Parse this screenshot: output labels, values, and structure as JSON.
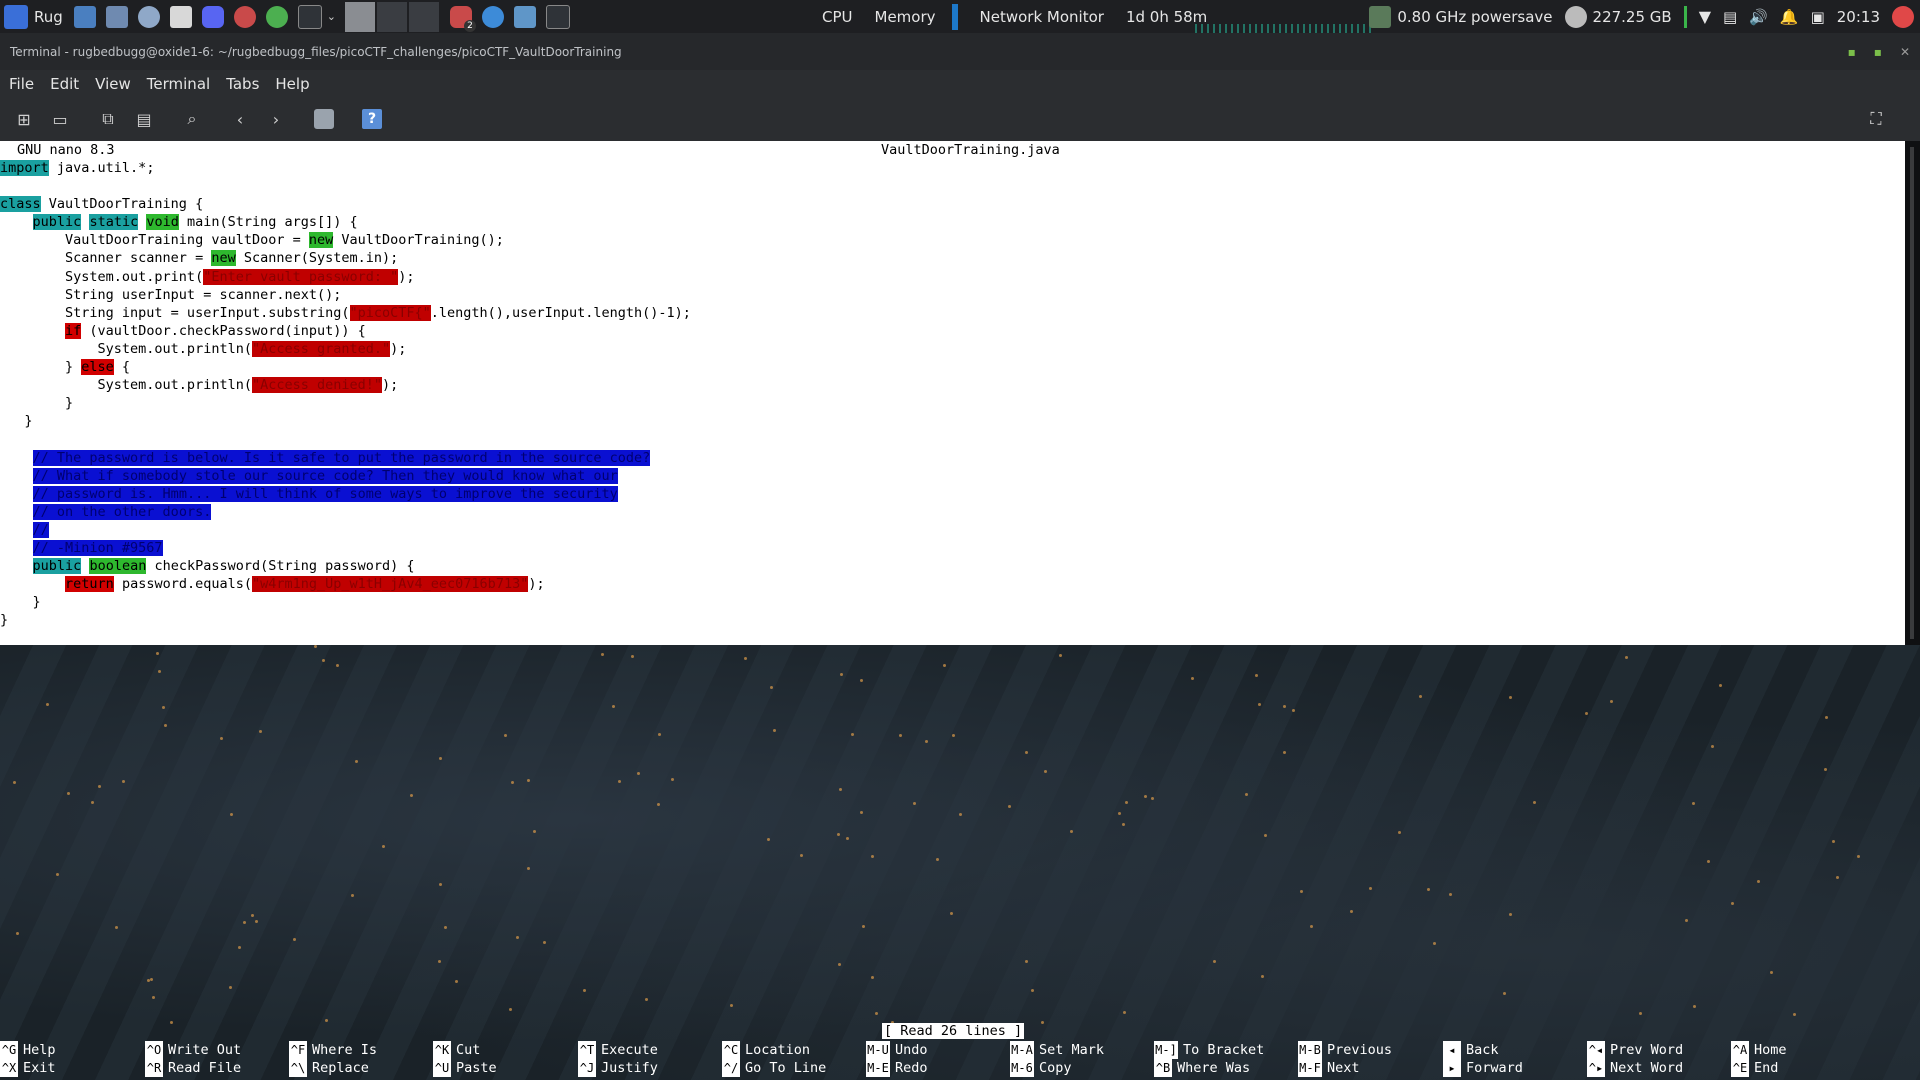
{
  "panel": {
    "menu_label": "Rug",
    "monitors": [
      "CPU",
      "Memory",
      "Network Monitor"
    ],
    "uptime": "1d 0h 58m",
    "cpu_freq": "0.80 GHz powersave",
    "disk": "227.25 GB",
    "clock": "20:13",
    "badge_count": "2",
    "accent": "#1d78c9"
  },
  "window": {
    "title": "Terminal - rugbedbugg@oxide1-6: ~/rugbedbugg_files/picoCTF_challenges/picoCTF_VaultDoorTraining"
  },
  "menubar": {
    "items": [
      "File",
      "Edit",
      "View",
      "Terminal",
      "Tabs",
      "Help"
    ]
  },
  "toolbar": {
    "help_label": "?"
  },
  "nano": {
    "version": "GNU nano 8.3",
    "filename": "VaultDoorTraining.java",
    "status": "[ Read 26 lines ]",
    "lines": [
      [
        {
          "t": "import",
          "c": "kw"
        },
        {
          "t": " java.util.*;",
          "c": ""
        }
      ],
      [],
      [
        {
          "t": "class",
          "c": "kw"
        },
        {
          "t": " VaultDoorTraining {",
          "c": ""
        }
      ],
      [
        {
          "t": "    ",
          "c": ""
        },
        {
          "t": "public",
          "c": "kw"
        },
        {
          "t": " ",
          "c": ""
        },
        {
          "t": "static",
          "c": "kw"
        },
        {
          "t": " ",
          "c": ""
        },
        {
          "t": "void",
          "c": "ty"
        },
        {
          "t": " main(String args[]) {",
          "c": ""
        }
      ],
      [
        {
          "t": "        VaultDoorTraining vaultDoor = ",
          "c": ""
        },
        {
          "t": "new",
          "c": "ty"
        },
        {
          "t": " VaultDoorTraining();",
          "c": ""
        }
      ],
      [
        {
          "t": "        Scanner scanner = ",
          "c": ""
        },
        {
          "t": "new",
          "c": "ty"
        },
        {
          "t": " Scanner(System.in);",
          "c": ""
        }
      ],
      [
        {
          "t": "        System.out.print(",
          "c": ""
        },
        {
          "t": "\"Enter vault password: \"",
          "c": "str"
        },
        {
          "t": ");",
          "c": ""
        }
      ],
      [
        {
          "t": "        String userInput = scanner.next();",
          "c": ""
        }
      ],
      [
        {
          "t": "        String input = userInput.substring(",
          "c": ""
        },
        {
          "t": "\"picoCTF{\"",
          "c": "str"
        },
        {
          "t": ".length(),userInput.length()-1);",
          "c": ""
        }
      ],
      [
        {
          "t": "        ",
          "c": ""
        },
        {
          "t": "if",
          "c": "ct"
        },
        {
          "t": " (vaultDoor.checkPassword(input)) {",
          "c": ""
        }
      ],
      [
        {
          "t": "            System.out.println(",
          "c": ""
        },
        {
          "t": "\"Access granted.\"",
          "c": "str"
        },
        {
          "t": ");",
          "c": ""
        }
      ],
      [
        {
          "t": "        } ",
          "c": ""
        },
        {
          "t": "else",
          "c": "ct"
        },
        {
          "t": " {",
          "c": ""
        }
      ],
      [
        {
          "t": "            System.out.println(",
          "c": ""
        },
        {
          "t": "\"Access denied!\"",
          "c": "str"
        },
        {
          "t": ");",
          "c": ""
        }
      ],
      [
        {
          "t": "        }",
          "c": ""
        }
      ],
      [
        {
          "t": "   }",
          "c": ""
        }
      ],
      [],
      [
        {
          "t": "    ",
          "c": ""
        },
        {
          "t": "// The password is below. Is it safe to put the password in the source code?",
          "c": "cm"
        }
      ],
      [
        {
          "t": "    ",
          "c": ""
        },
        {
          "t": "// What if somebody stole our source code? Then they would know what our",
          "c": "cm"
        }
      ],
      [
        {
          "t": "    ",
          "c": ""
        },
        {
          "t": "// password is. Hmm... I will think of some ways to improve the security",
          "c": "cm"
        }
      ],
      [
        {
          "t": "    ",
          "c": ""
        },
        {
          "t": "// on the other doors.",
          "c": "cm"
        }
      ],
      [
        {
          "t": "    ",
          "c": ""
        },
        {
          "t": "//",
          "c": "cm"
        }
      ],
      [
        {
          "t": "    ",
          "c": ""
        },
        {
          "t": "// -Minion #9567",
          "c": "cm"
        }
      ],
      [
        {
          "t": "    ",
          "c": ""
        },
        {
          "t": "public",
          "c": "kw"
        },
        {
          "t": " ",
          "c": ""
        },
        {
          "t": "boolean",
          "c": "ty"
        },
        {
          "t": " checkPassword(String password) {",
          "c": ""
        }
      ],
      [
        {
          "t": "        ",
          "c": ""
        },
        {
          "t": "return",
          "c": "ct"
        },
        {
          "t": " password.equals(",
          "c": ""
        },
        {
          "t": "\"w4rm1ng_Up_w1tH_jAv4_eec0716b713\"",
          "c": "str"
        },
        {
          "t": ");",
          "c": ""
        }
      ],
      [
        {
          "t": "    }",
          "c": ""
        }
      ],
      [
        {
          "t": "}",
          "c": ""
        }
      ]
    ],
    "shortcuts": [
      {
        "k1": "^G",
        "l1": "Help",
        "k2": "^X",
        "l2": "Exit"
      },
      {
        "k1": "^O",
        "l1": "Write Out",
        "k2": "^R",
        "l2": "Read File"
      },
      {
        "k1": "^F",
        "l1": "Where Is",
        "k2": "^\\",
        "l2": "Replace"
      },
      {
        "k1": "^K",
        "l1": "Cut",
        "k2": "^U",
        "l2": "Paste"
      },
      {
        "k1": "^T",
        "l1": "Execute",
        "k2": "^J",
        "l2": "Justify"
      },
      {
        "k1": "^C",
        "l1": "Location",
        "k2": "^/",
        "l2": "Go To Line"
      },
      {
        "k1": "M-U",
        "l1": "Undo",
        "k2": "M-E",
        "l2": "Redo"
      },
      {
        "k1": "M-A",
        "l1": "Set Mark",
        "k2": "M-6",
        "l2": "Copy"
      },
      {
        "k1": "M-]",
        "l1": "To Bracket",
        "k2": "^B",
        "l2": "Where Was"
      },
      {
        "k1": "M-B",
        "l1": "Previous",
        "k2": "M-F",
        "l2": "Next"
      },
      {
        "k1": "◂",
        "l1": "Back",
        "k2": "▸",
        "l2": "Forward"
      },
      {
        "k1": "^◂",
        "l1": "Prev Word",
        "k2": "^▸",
        "l2": "Next Word"
      },
      {
        "k1": "^A",
        "l1": "Home",
        "k2": "^E",
        "l2": "End"
      }
    ]
  }
}
